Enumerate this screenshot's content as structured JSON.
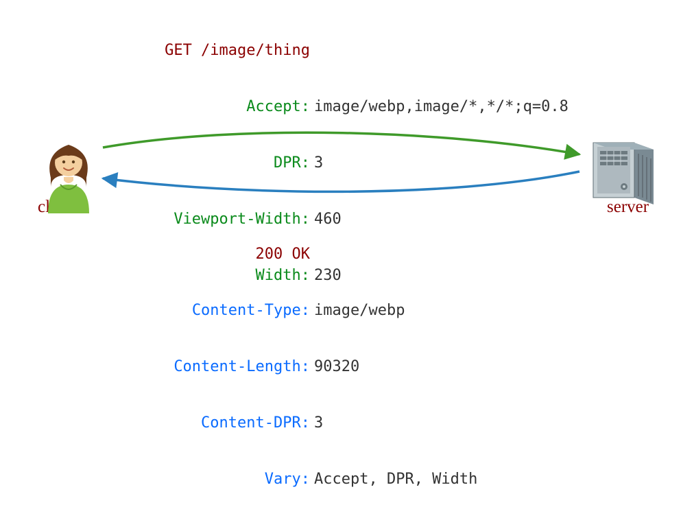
{
  "labels": {
    "client": "client",
    "server": "server"
  },
  "colors": {
    "maroon": "#8b0000",
    "green": "#0a8a1b",
    "blue": "#0a6bff",
    "req_arrow": "#3f9a2a",
    "resp_arrow": "#2a7fbf"
  },
  "request": {
    "first_line": "GET /image/thing",
    "headers": [
      {
        "k": "Accept:",
        "v": "image/webp,image/*,*/*;q=0.8"
      },
      {
        "k": "DPR:",
        "v": "3"
      },
      {
        "k": "Viewport-Width:",
        "v": "460"
      },
      {
        "k": "Width:",
        "v": "230"
      }
    ]
  },
  "response": {
    "first_line": "200 OK",
    "headers": [
      {
        "k": "Content-Type:",
        "v": "image/webp"
      },
      {
        "k": "Content-Length:",
        "v": "90320"
      },
      {
        "k": "Content-DPR:",
        "v": "3"
      },
      {
        "k": "Vary:",
        "v": "Accept, DPR, Width"
      }
    ]
  }
}
